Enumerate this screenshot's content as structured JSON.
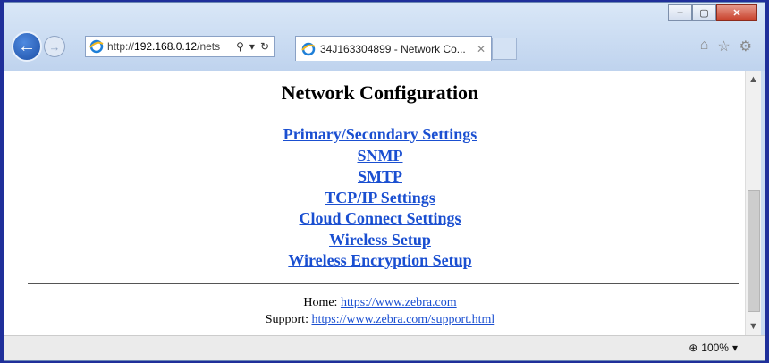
{
  "browser": {
    "address_url_prefix": "http://",
    "address_url_host": "192.168.0.12",
    "address_url_suffix": "/nets",
    "tab_title": "34J163304899 - Network Co...",
    "zoom_level": "100%"
  },
  "page": {
    "heading": "Network Configuration",
    "links": [
      "Primary/Secondary Settings",
      "SNMP",
      "SMTP",
      "TCP/IP Settings",
      "Cloud Connect Settings",
      "Wireless Setup",
      "Wireless Encryption Setup"
    ],
    "footer": {
      "home_label": "Home:",
      "home_url": "https://www.zebra.com",
      "support_label": "Support:",
      "support_url": "https://www.zebra.com/support.html"
    }
  },
  "icons": [
    "back-arrow-icon",
    "forward-arrow-icon",
    "ie-icon",
    "search-icon",
    "dropdown-icon",
    "refresh-icon",
    "close-tab-icon",
    "home-icon",
    "favorites-star-icon",
    "gear-icon",
    "zoom-icon"
  ]
}
